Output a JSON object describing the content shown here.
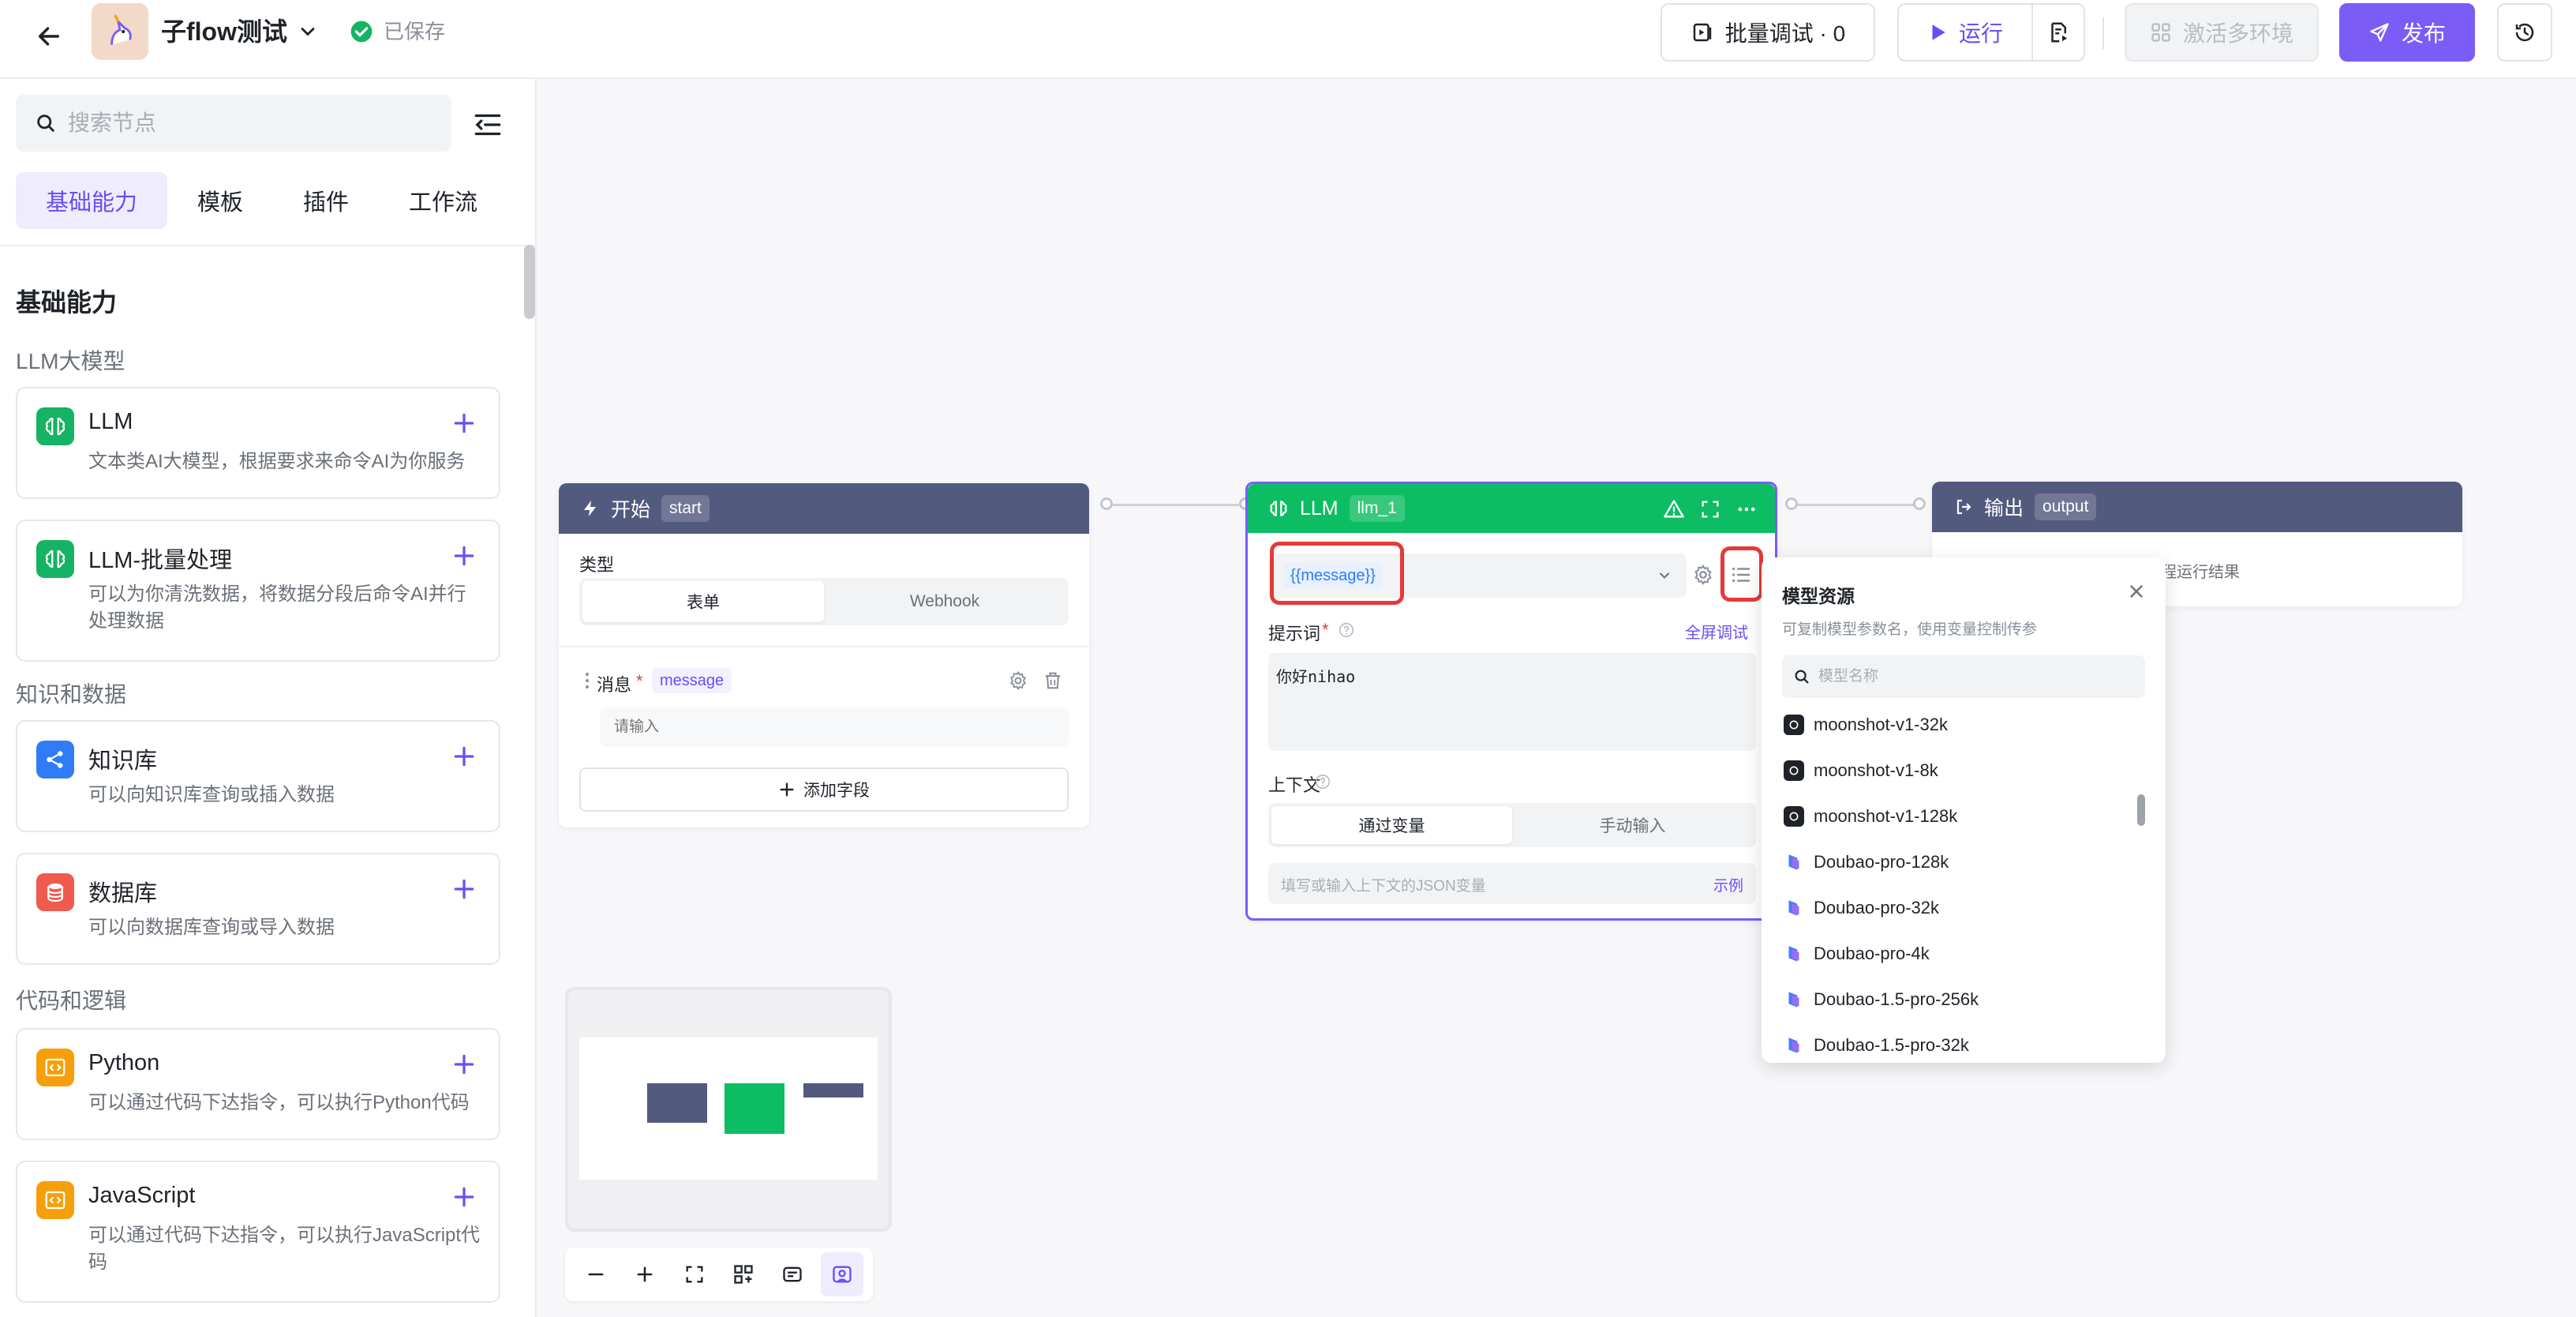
{
  "header": {
    "title": "子flow测试",
    "saved": "已保存",
    "batch_debug": "批量调试 · 0",
    "run": "运行",
    "multi_env": "激活多环境",
    "publish": "发布"
  },
  "sidebar": {
    "search_placeholder": "搜索节点",
    "tabs": [
      "基础能力",
      "模板",
      "插件",
      "工作流"
    ],
    "section_title": "基础能力",
    "groups": [
      "LLM大模型",
      "知识和数据",
      "代码和逻辑"
    ],
    "cards": [
      {
        "name": "LLM",
        "desc": "文本类AI大模型，根据要求来命令AI为你服务",
        "icon": "brain-icon",
        "color": "#16b364"
      },
      {
        "name": "LLM-批量处理",
        "desc": "可以为你清洗数据，将数据分段后命令AI并行处理数据",
        "icon": "brain-icon",
        "color": "#16b364"
      },
      {
        "name": "知识库",
        "desc": "可以向知识库查询或插入数据",
        "icon": "share-icon",
        "color": "#2f7cf6"
      },
      {
        "name": "数据库",
        "desc": "可以向数据库查询或导入数据",
        "icon": "database-icon",
        "color": "#f05a4f"
      },
      {
        "name": "Python",
        "desc": "可以通过代码下达指令，可以执行Python代码",
        "icon": "code-icon",
        "color": "#f5a00b"
      },
      {
        "name": "JavaScript",
        "desc": "可以通过代码下达指令，可以执行JavaScript代码",
        "icon": "code-icon",
        "color": "#f5a00b"
      }
    ]
  },
  "start_node": {
    "title": "开始",
    "tag": "start",
    "type_label": "类型",
    "type_options": [
      "表单",
      "Webhook"
    ],
    "field_label": "消息",
    "field_required": "*",
    "field_tag": "message",
    "field_placeholder": "请输入",
    "add_field": "添加字段",
    "color": "#525a7e"
  },
  "llm_node": {
    "title": "LLM",
    "tag": "llm_1",
    "model_value": "{{message}}",
    "prompt_label": "提示词",
    "prompt_required": "*",
    "fullscreen_debug": "全屏调试",
    "prompt_text": "你好nihao",
    "context_label": "上下文",
    "context_options": [
      "通过变量",
      "手动输入"
    ],
    "context_placeholder": "填写或输入上下文的JSON变量",
    "example": "示例",
    "color": "#0dbd63"
  },
  "output_node": {
    "title": "输出",
    "tag": "output",
    "desc": "程运行结果",
    "color": "#525a7e"
  },
  "popover": {
    "title": "模型资源",
    "subtitle": "可复制模型参数名，使用变量控制传参",
    "search_placeholder": "模型名称",
    "items": [
      {
        "name": "moonshot-v1-32k",
        "icon": "moonshot-icon"
      },
      {
        "name": "moonshot-v1-8k",
        "icon": "moonshot-icon"
      },
      {
        "name": "moonshot-v1-128k",
        "icon": "moonshot-icon"
      },
      {
        "name": "Doubao-pro-128k",
        "icon": "doubao-icon"
      },
      {
        "name": "Doubao-pro-32k",
        "icon": "doubao-icon"
      },
      {
        "name": "Doubao-pro-4k",
        "icon": "doubao-icon"
      },
      {
        "name": "Doubao-1.5-pro-256k",
        "icon": "doubao-icon"
      },
      {
        "name": "Doubao-1.5-pro-32k",
        "icon": "doubao-icon"
      }
    ]
  },
  "colors": {
    "accent": "#7b5cf7",
    "highlight": "#e43a3a"
  }
}
